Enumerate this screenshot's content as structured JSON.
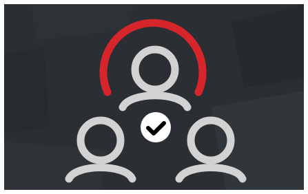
{
  "image": {
    "subject": "group-of-users-with-checkmark",
    "icons": [
      "user-icon",
      "user-icon",
      "user-icon",
      "checkmark-icon"
    ],
    "colors": {
      "background": "#2b2f33",
      "background_panel_dark": "#272a2e",
      "background_panel_light": "#31363b",
      "user_outline": "#d2d2d2",
      "arc": "#d7262b",
      "badge": "#ffffff",
      "check": "#000000"
    }
  }
}
